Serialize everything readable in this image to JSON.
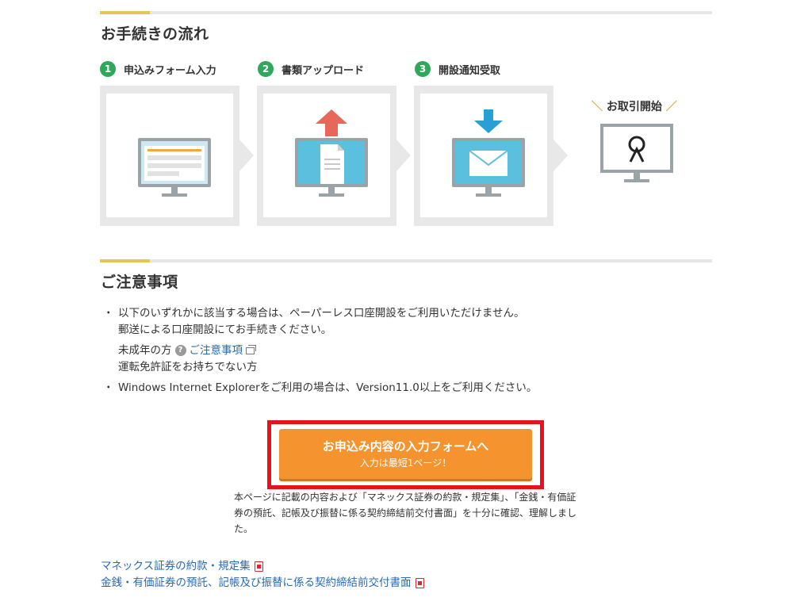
{
  "flow_section": {
    "title": "お手続きの流れ",
    "steps": [
      {
        "number": "1",
        "label": "申込みフォーム入力",
        "icon": "form-monitor-icon"
      },
      {
        "number": "2",
        "label": "書類アップロード",
        "icon": "document-upload-icon"
      },
      {
        "number": "3",
        "label": "開設通知受取",
        "icon": "mail-receive-icon"
      }
    ],
    "final_step": {
      "label": "お取引開始",
      "icon": "trade-start-icon"
    }
  },
  "notes_section": {
    "title": "ご注意事項",
    "bullet_mark": "・",
    "item1_line1": "以下のいずれかに該当する場合は、ペーパーレス口座開設をご利用いただけません。",
    "item1_line2": "郵送による口座開設にてお手続きください。",
    "sub_minor": "未成年の方",
    "sub_minor_link": "ご注意事項",
    "sub_license": "運転免許証をお持ちでない方",
    "item2": "Windows Internet Explorerをご利用の場合は、Version11.0以上をご利用ください。"
  },
  "apply_button": {
    "main_label": "お申込み内容の入力フォームへ",
    "sub_label": "入力は最短1ページ！"
  },
  "consent_text": "本ページに記載の内容および「マネックス証券の約款・規定集」、「金銭・有価証券の預託、記帳及び振替に係る契約締結前交付書面」を十分に確認、理解しました。",
  "document_links": [
    {
      "label": "マネックス証券の約款・規定集",
      "icon": "pdf-icon"
    },
    {
      "label": "金銭・有価証券の預託、記帳及び振替に係る契約締結前交付書面",
      "icon": "pdf-icon"
    }
  ],
  "colors": {
    "accent_gold": "#e8c35a",
    "step_green": "#2fa85b",
    "button_orange": "#f5932e",
    "highlight_red": "#e5131b",
    "link_blue": "#2a6bb0"
  }
}
